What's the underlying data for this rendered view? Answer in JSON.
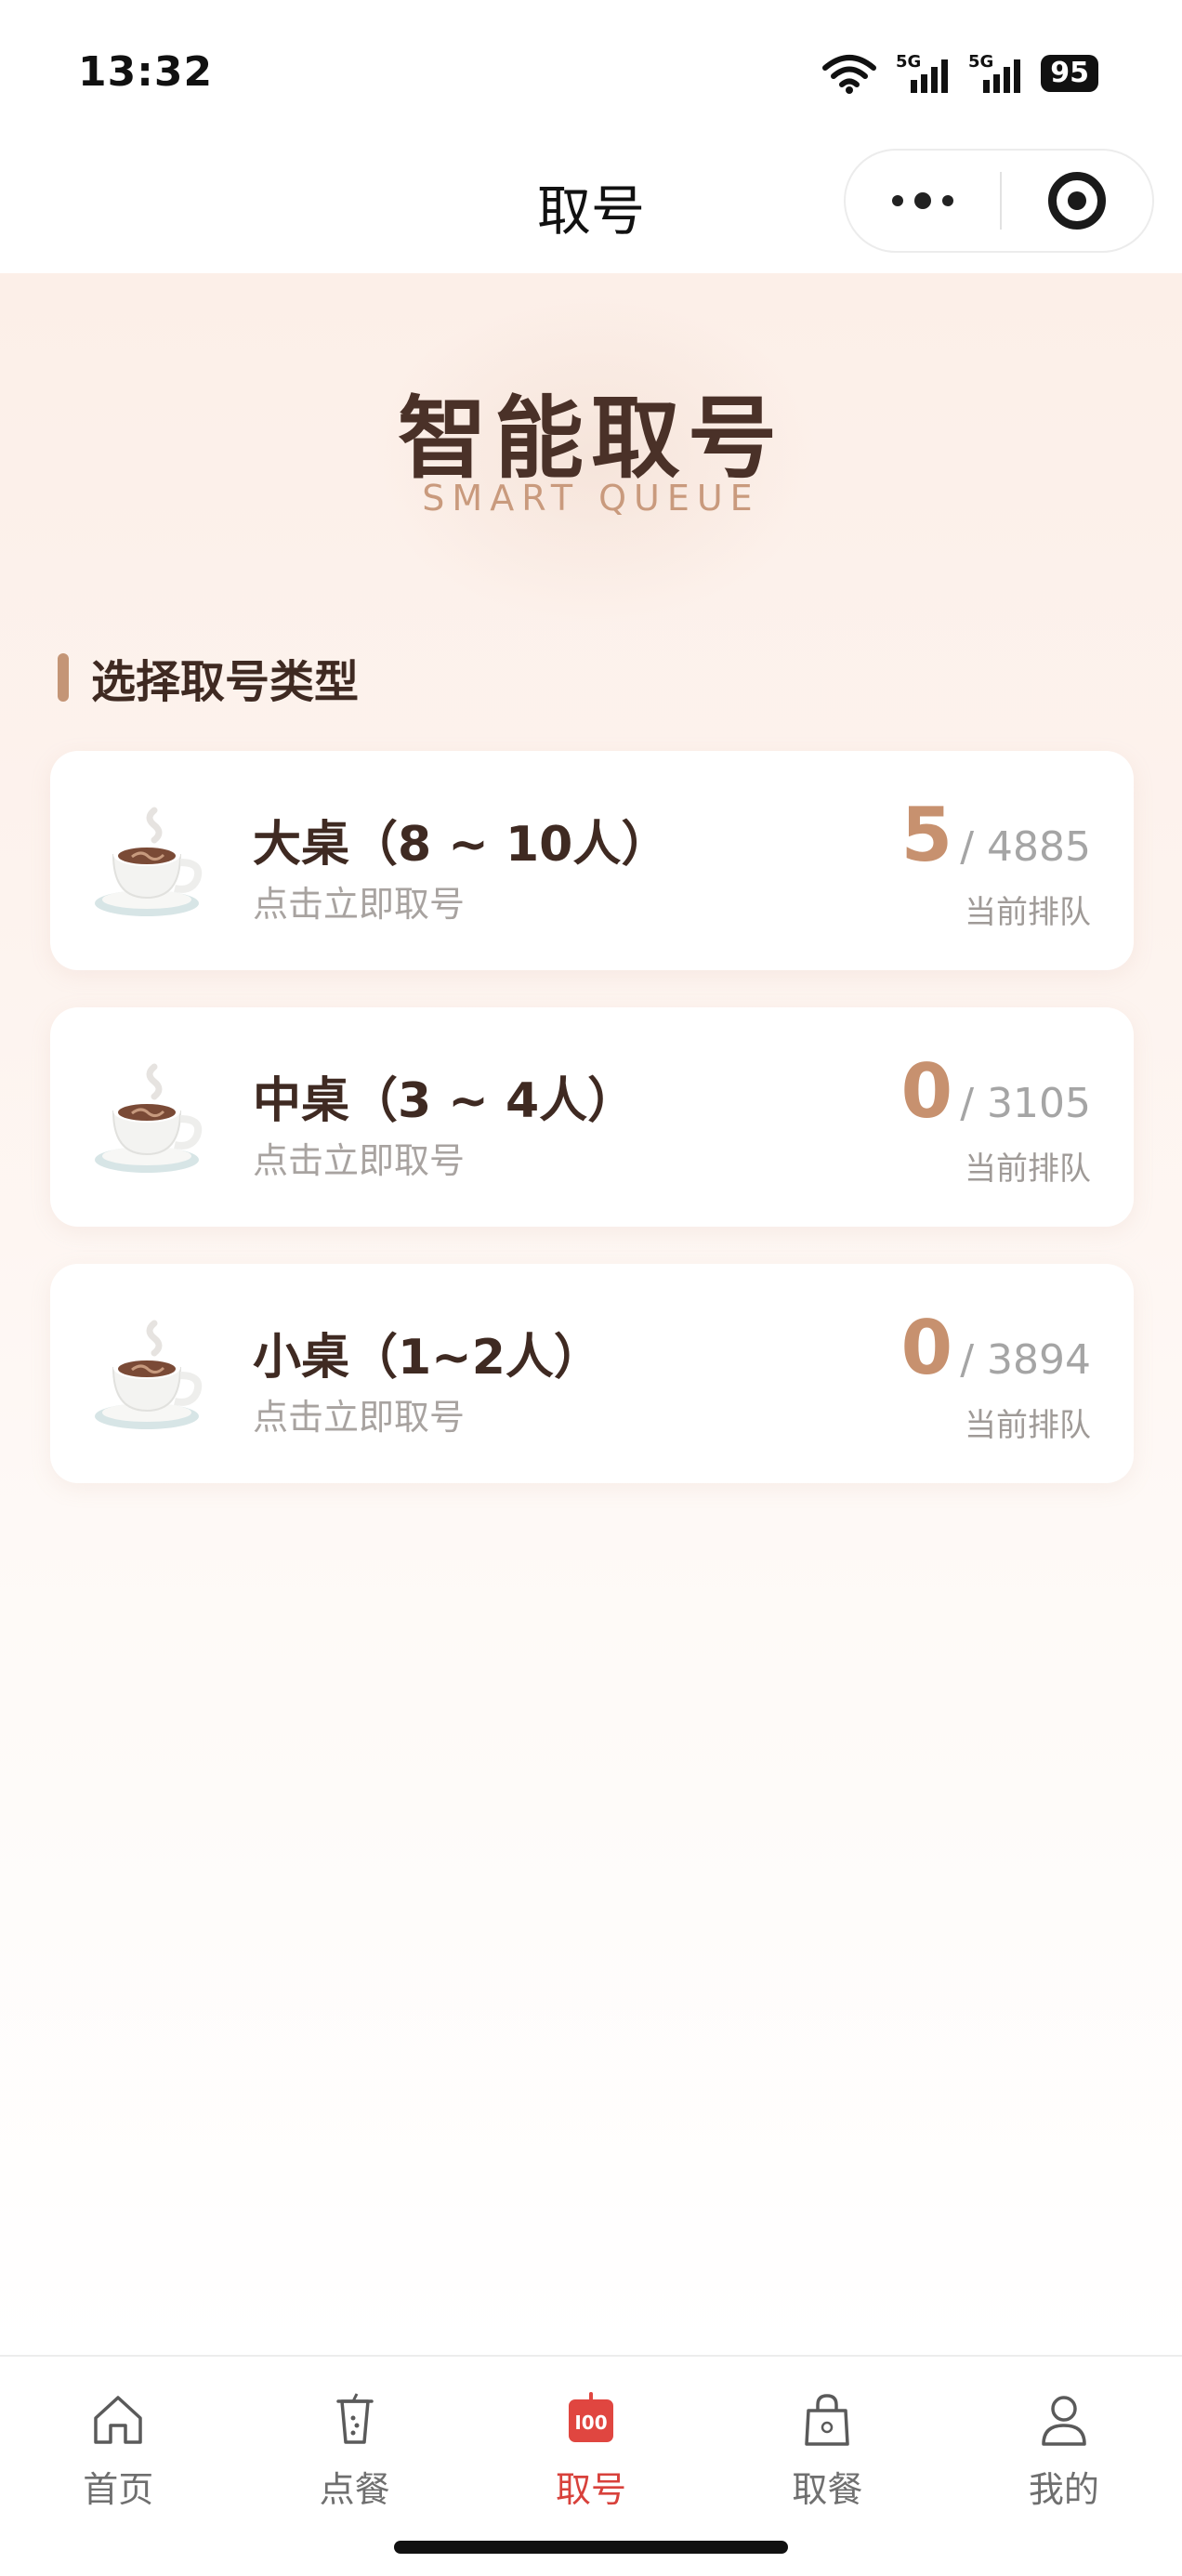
{
  "status_bar": {
    "time": "13:32",
    "signal_1_label": "5G",
    "signal_2_label": "5G",
    "battery": "95"
  },
  "nav": {
    "title": "取号"
  },
  "hero": {
    "title": "智能取号",
    "subtitle": "SMART QUEUE"
  },
  "section": {
    "title": "选择取号类型"
  },
  "tables": [
    {
      "name": "大桌（8 ~ 10人）",
      "hint": "点击立即取号",
      "count": "5",
      "total": "/ 4885",
      "queue_label": "当前排队",
      "icon": "coffee-cup-icon"
    },
    {
      "name": "中桌（3 ~ 4人）",
      "hint": "点击立即取号",
      "count": "0",
      "total": "/ 3105",
      "queue_label": "当前排队",
      "icon": "coffee-cup-icon"
    },
    {
      "name": "小桌（1~2人）",
      "hint": "点击立即取号",
      "count": "0",
      "total": "/ 3894",
      "queue_label": "当前排队",
      "icon": "coffee-cup-icon"
    }
  ],
  "tab_bar": {
    "items": [
      {
        "label": "首页",
        "icon": "home-icon",
        "active": false
      },
      {
        "label": "点餐",
        "icon": "drink-cup-icon",
        "active": false
      },
      {
        "label": "取号",
        "icon": "queue-number-icon",
        "active": true
      },
      {
        "label": "取餐",
        "icon": "shopping-bag-icon",
        "active": false
      },
      {
        "label": "我的",
        "icon": "user-icon",
        "active": false
      }
    ]
  },
  "colors": {
    "accent": "#c7916f",
    "active_tab": "#d8413b",
    "title_brown": "#4a3128"
  }
}
